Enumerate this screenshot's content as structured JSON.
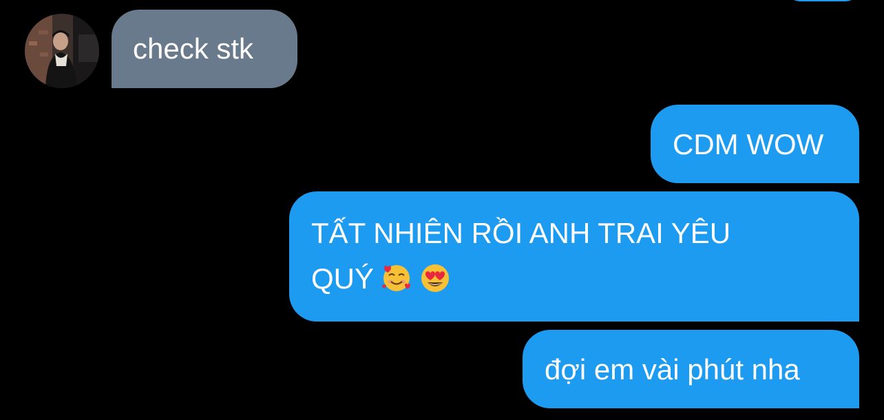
{
  "conversation": {
    "received": [
      {
        "text": "check stk"
      }
    ],
    "sent": [
      {
        "text": "CDM WOW"
      },
      {
        "line1": "TẤT NHIÊN RỒI ANH TRAI YÊU",
        "line2": "QUÝ",
        "emojis": [
          "smiling-face-with-hearts",
          "heart-eyes"
        ]
      },
      {
        "text": "đợi em vài phút nha"
      }
    ]
  },
  "colors": {
    "background": "#000000",
    "received_bubble": "#687a8c",
    "sent_bubble": "#1d9bf0",
    "text": "#ffffff"
  }
}
